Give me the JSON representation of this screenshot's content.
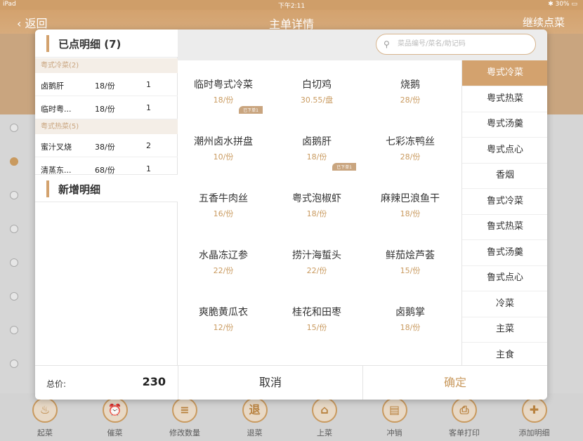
{
  "status": {
    "device": "iPad",
    "time": "下午2:11",
    "battery": "30%"
  },
  "nav": {
    "back": "返回",
    "title": "主单详情",
    "right": "继续点菜"
  },
  "left_panel": {
    "ordered_title": "已点明细 (7)",
    "groups": [
      {
        "name": "粤式冷菜(2)",
        "items": [
          {
            "name": "卤鹅肝",
            "price": "18/份",
            "qty": "1"
          },
          {
            "name": "临时粤...",
            "price": "18/份",
            "qty": "1"
          }
        ]
      },
      {
        "name": "粤式热菜(5)",
        "items": [
          {
            "name": "蜜汁叉烧",
            "price": "38/份",
            "qty": "2"
          },
          {
            "name": "清蒸东...",
            "price": "68/份",
            "qty": "1"
          }
        ]
      }
    ],
    "new_title": "新增明细"
  },
  "search": {
    "placeholder": "菜品编号/菜名/助记码"
  },
  "dishes": [
    {
      "name": "临时粤式冷菜",
      "price": "18/份",
      "tag": "已下单1"
    },
    {
      "name": "白切鸡",
      "price": "30.55/盘",
      "tag": ""
    },
    {
      "name": "烧鹅",
      "price": "28/份",
      "tag": ""
    },
    {
      "name": "潮州卤水拼盘",
      "price": "10/份",
      "tag": ""
    },
    {
      "name": "卤鹅肝",
      "price": "18/份",
      "tag": "已下单1"
    },
    {
      "name": "七彩冻鸭丝",
      "price": "28/份",
      "tag": ""
    },
    {
      "name": "五香牛肉丝",
      "price": "16/份",
      "tag": ""
    },
    {
      "name": "粤式泡椒虾",
      "price": "18/份",
      "tag": ""
    },
    {
      "name": "麻辣巴浪鱼干",
      "price": "18/份",
      "tag": ""
    },
    {
      "name": "水晶冻辽参",
      "price": "22/份",
      "tag": ""
    },
    {
      "name": "捞汁海蜇头",
      "price": "22/份",
      "tag": ""
    },
    {
      "name": "鲜茄烩芦荟",
      "price": "15/份",
      "tag": ""
    },
    {
      "name": "爽脆黄瓜衣",
      "price": "12/份",
      "tag": ""
    },
    {
      "name": "桂花和田枣",
      "price": "15/份",
      "tag": ""
    },
    {
      "name": "卤鹅掌",
      "price": "18/份",
      "tag": ""
    }
  ],
  "categories": [
    "粤式冷菜",
    "粤式热菜",
    "粤式汤羹",
    "粤式点心",
    "香烟",
    "鲁式冷菜",
    "鲁式热菜",
    "鲁式汤羹",
    "鲁式点心",
    "冷菜",
    "主菜",
    "主食"
  ],
  "active_category": "粤式冷菜",
  "footer": {
    "total_label": "总价:",
    "total_value": "230",
    "cancel": "取消",
    "confirm": "确定"
  },
  "toolbar": [
    {
      "label": "起菜",
      "glyph": "♨"
    },
    {
      "label": "催菜",
      "glyph": "⏰"
    },
    {
      "label": "修改数量",
      "glyph": "≡"
    },
    {
      "label": "退菜",
      "glyph": "退"
    },
    {
      "label": "上菜",
      "glyph": "⌂"
    },
    {
      "label": "冲销",
      "glyph": "▤"
    },
    {
      "label": "客单打印",
      "glyph": "⎙"
    },
    {
      "label": "添加明细",
      "glyph": "✚"
    }
  ],
  "colors": {
    "accent": "#d3a26e",
    "price": "#c99a5f"
  }
}
